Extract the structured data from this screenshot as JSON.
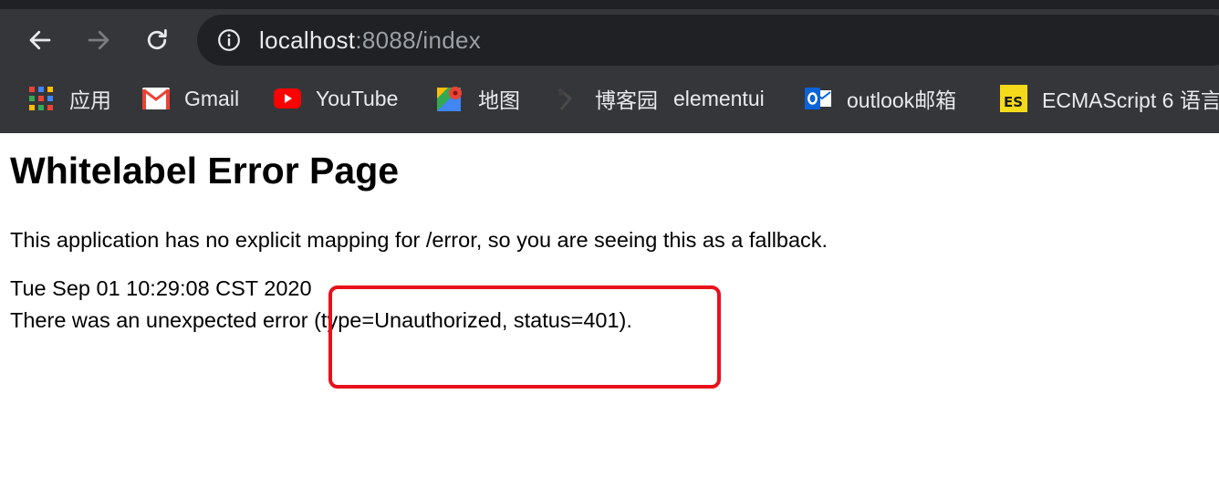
{
  "browser": {
    "url_host": "localhost",
    "url_path": ":8088/index",
    "icons": {
      "back": "arrow-left-icon",
      "forward": "arrow-right-icon",
      "reload": "reload-icon",
      "site_info": "info-circle-icon"
    },
    "bookmarks": [
      {
        "label": "应用",
        "icon": "apps-grid-icon"
      },
      {
        "label": "Gmail",
        "icon": "gmail-icon"
      },
      {
        "label": "YouTube",
        "icon": "youtube-icon"
      },
      {
        "label": "地图",
        "icon": "google-maps-icon"
      },
      {
        "label": "博客园",
        "icon": "cnblogs-icon"
      },
      {
        "label": "elementui",
        "icon": ""
      },
      {
        "label": "outlook邮箱",
        "icon": "outlook-icon"
      },
      {
        "label": "ECMAScript 6 语言",
        "icon": "es-icon"
      }
    ],
    "colors": {
      "chrome_bg": "#35363a",
      "omnibox_bg": "#202124",
      "text": "#e8eaed",
      "muted_text": "#9aa0a6"
    }
  },
  "page": {
    "title": "Whitelabel Error Page",
    "description": "This application has no explicit mapping for /error, so you are seeing this as a fallback.",
    "timestamp": "Tue Sep 01 10:29:08 CST 2020",
    "error_message": "There was an unexpected error (type=Unauthorized, status=401).",
    "highlight_color": "#e8101b"
  }
}
